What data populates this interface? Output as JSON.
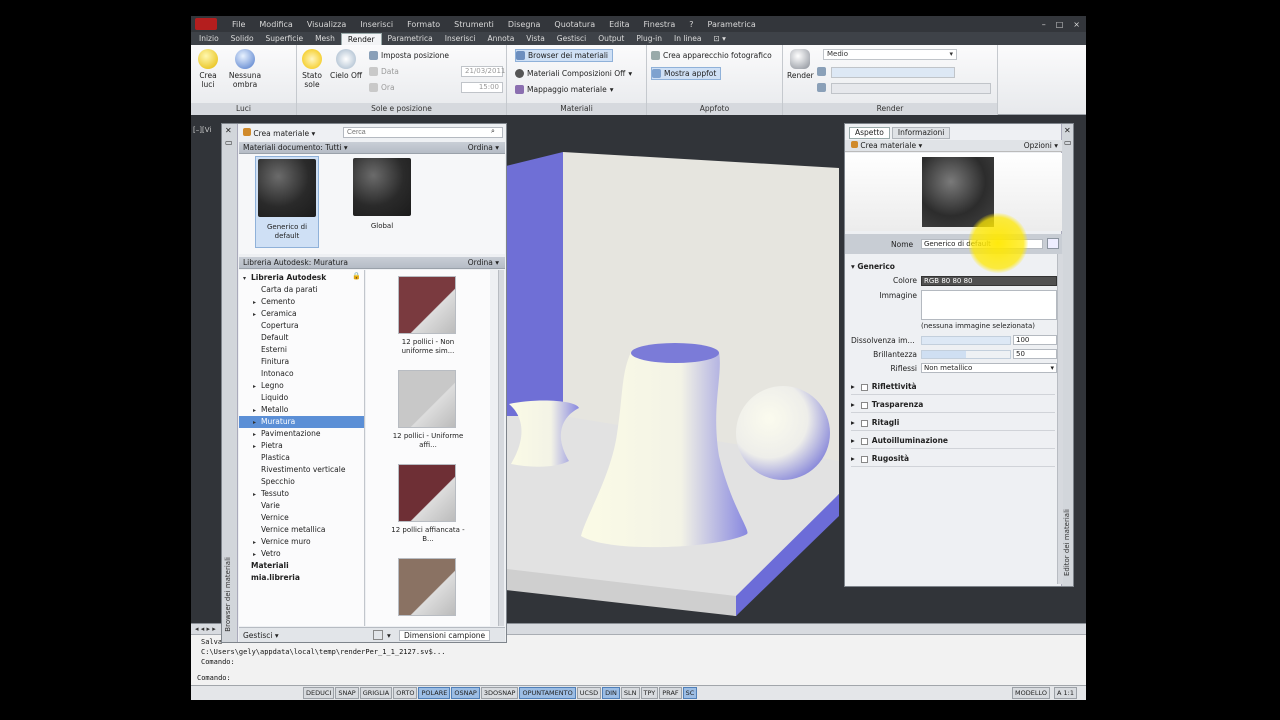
{
  "menu": [
    "File",
    "Modifica",
    "Visualizza",
    "Inserisci",
    "Formato",
    "Strumenti",
    "Disegna",
    "Quotatura",
    "Edita",
    "Finestra",
    "?",
    "Parametrica"
  ],
  "window_buttons": [
    "–",
    "□",
    "×"
  ],
  "ribbon_tabs": [
    "Inizio",
    "Solido",
    "Superficie",
    "Mesh",
    "Render",
    "Parametrica",
    "Inserisci",
    "Annota",
    "Vista",
    "Gestisci",
    "Output",
    "Plug-in",
    "In linea",
    "⊡ ▾"
  ],
  "active_tab": "Render",
  "ribbon": {
    "luci": {
      "title": "Luci",
      "crea_luci": "Crea luci",
      "ombre": "Nessuna ombra",
      "stato_sole": "Stato sole",
      "cielo": "Cielo Off"
    },
    "sole": {
      "title": "Sole e posizione",
      "imposta": "Imposta posizione",
      "data_label": "Data",
      "data_value": "21/03/2011",
      "ora_label": "Ora",
      "ora_value": "15:00"
    },
    "materiali": {
      "title": "Materiali",
      "browser": "Browser dei materiali",
      "composizioni": "Materiali Composizioni Off",
      "mappaggio": "Mappaggio materiale"
    },
    "appfoto": {
      "title": "Appfoto",
      "crea": "Crea apparecchio fotografico",
      "mostra": "Mostra appfot"
    },
    "render": {
      "title": "Render",
      "render_btn": "Render",
      "quality": "Medio"
    }
  },
  "viewport_label": "[–][Vi",
  "browser": {
    "vertical_title": "Browser dei materiali",
    "crea": "Crea materiale",
    "search_placeholder": "Cerca",
    "doc_header": "Materiali documento: Tutti",
    "order": "Ordina",
    "doc_materials": [
      "Generico di default",
      "Global"
    ],
    "lib_header": "Libreria Autodesk: Muratura",
    "tree": [
      {
        "label": "Libreria Autodesk",
        "bold": true,
        "arrow": "▾",
        "indent": 0
      },
      {
        "label": "Carta da parati",
        "indent": 1
      },
      {
        "label": "Cemento",
        "arrow": "▸",
        "indent": 1
      },
      {
        "label": "Ceramica",
        "arrow": "▸",
        "indent": 1
      },
      {
        "label": "Copertura",
        "indent": 1
      },
      {
        "label": "Default",
        "indent": 1
      },
      {
        "label": "Esterni",
        "indent": 1
      },
      {
        "label": "Finitura",
        "indent": 1
      },
      {
        "label": "Intonaco",
        "indent": 1
      },
      {
        "label": "Legno",
        "arrow": "▸",
        "indent": 1
      },
      {
        "label": "Liquido",
        "indent": 1
      },
      {
        "label": "Metallo",
        "arrow": "▸",
        "indent": 1
      },
      {
        "label": "Muratura",
        "arrow": "▸",
        "indent": 1,
        "selected": true
      },
      {
        "label": "Pavimentazione",
        "arrow": "▸",
        "indent": 1
      },
      {
        "label": "Pietra",
        "arrow": "▸",
        "indent": 1
      },
      {
        "label": "Plastica",
        "indent": 1
      },
      {
        "label": "Rivestimento verticale",
        "indent": 1
      },
      {
        "label": "Specchio",
        "indent": 1
      },
      {
        "label": "Tessuto",
        "arrow": "▸",
        "indent": 1
      },
      {
        "label": "Varie",
        "indent": 1
      },
      {
        "label": "Vernice",
        "indent": 1
      },
      {
        "label": "Vernice metallica",
        "indent": 1
      },
      {
        "label": "Vernice muro",
        "arrow": "▸",
        "indent": 1
      },
      {
        "label": "Vetro",
        "arrow": "▸",
        "indent": 1
      },
      {
        "label": "Materiali",
        "bold": true,
        "indent": 0
      },
      {
        "label": "mia.libreria",
        "bold": true,
        "indent": 0
      }
    ],
    "thumbs": [
      {
        "label": "12 pollici - Non uniforme sim...",
        "color": "#7a3a3f"
      },
      {
        "label": "12 pollici - Uniforme affi...",
        "color": "#c8c8c8"
      },
      {
        "label": "12 pollici affiancata - B...",
        "color": "#6e2f35"
      },
      {
        "label": "",
        "color": "#8a7263"
      }
    ],
    "footer_manage": "Gestisci",
    "footer_size": "Dimensioni campione"
  },
  "editor": {
    "tabs": [
      "Aspetto",
      "Informazioni"
    ],
    "crea": "Crea materiale",
    "options": "Opzioni",
    "name_label": "Nome",
    "name_value": "Generico di default",
    "section_generico": "Generico",
    "colore_label": "Colore",
    "colore_value": "RGB 80 80 80",
    "immagine_label": "Immagine",
    "no_image": "(nessuna immagine selezionata)",
    "dissolvenza_label": "Dissolvenza im...",
    "dissolvenza_value": "100",
    "brillantezza_label": "Brillantezza",
    "brillantezza_value": "50",
    "riflessi_label": "Riflessi",
    "riflessi_value": "Non metallico",
    "sections": [
      "Riflettività",
      "Trasparenza",
      "Ritagli",
      "Autoilluminazione",
      "Rugosità"
    ],
    "vertical_title": "Editor dei materiali"
  },
  "command": {
    "lines": [
      "Salva",
      "C:\\Users\\gely\\appdata\\local\\temp\\renderPer_1_1_2127.sv$...",
      "Comando:"
    ],
    "prompt": "Comando:"
  },
  "status_left": [
    "DEDUCI",
    "SNAP",
    "GRIGLIA",
    "ORTO",
    "POLARE",
    "OSNAP",
    "3DOSNAP",
    "OPUNTAMENTO",
    "UCSD",
    "DIN",
    "SLN",
    "TPY",
    "PRAF",
    "SC"
  ],
  "status_on": [
    "POLARE",
    "OSNAP",
    "OPUNTAMENTO",
    "DIN",
    "SC"
  ],
  "status_right": [
    "MODELLO",
    "A 1:1"
  ],
  "colors": {
    "accent": "#5b8fd6",
    "wall_blue": "#6f6fd6",
    "cursor_highlight": "#ffe600"
  }
}
